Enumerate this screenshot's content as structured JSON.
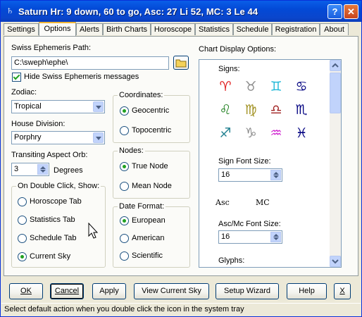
{
  "window": {
    "title": "Saturn Hr: 9 down, 60 to go, Asc: 27 Li 52, MC: 3 Le 44",
    "app_icon": "saturn-glyph",
    "help_btn": "?",
    "close_btn": "✕"
  },
  "tabs": [
    {
      "label": "Settings",
      "selected": false
    },
    {
      "label": "Options",
      "selected": true
    },
    {
      "label": "Alerts",
      "selected": false
    },
    {
      "label": "Birth Charts",
      "selected": false
    },
    {
      "label": "Horoscope",
      "selected": false
    },
    {
      "label": "Statistics",
      "selected": false
    },
    {
      "label": "Schedule",
      "selected": false
    },
    {
      "label": "Registration",
      "selected": false
    },
    {
      "label": "About",
      "selected": false
    }
  ],
  "ephemeris": {
    "label": "Swiss Ephemeris Path:",
    "value": "C:\\sweph\\ephe\\",
    "hide_label": "Hide Swiss Ephemeris messages",
    "hide_checked": true
  },
  "zodiac": {
    "label": "Zodiac:",
    "value": "Tropical"
  },
  "house": {
    "label": "House Division:",
    "value": "Porphry"
  },
  "orb": {
    "label": "Transiting Aspect Orb:",
    "value": "3",
    "unit": "Degrees"
  },
  "double_click": {
    "title": "On Double Click, Show:",
    "options": [
      "Horoscope Tab",
      "Statistics Tab",
      "Schedule Tab",
      "Current Sky"
    ],
    "selected": 3
  },
  "coordinates": {
    "title": "Coordinates:",
    "options": [
      "Geocentric",
      "Topocentric"
    ],
    "selected": 0
  },
  "nodes": {
    "title": "Nodes:",
    "options": [
      "True Node",
      "Mean Node"
    ],
    "selected": 0
  },
  "date_format": {
    "title": "Date Format:",
    "options": [
      "European",
      "American",
      "Scientific"
    ],
    "selected": 0
  },
  "chart_display": {
    "title": "Chart Display Options:",
    "signs_label": "Signs:",
    "signs": [
      {
        "glyph": "♈",
        "color": "#e02020"
      },
      {
        "glyph": "♉",
        "color": "#8c8c8c"
      },
      {
        "glyph": "♊",
        "color": "#20b8d8"
      },
      {
        "glyph": "♋",
        "color": "#000080"
      },
      {
        "glyph": "♌",
        "color": "#208020"
      },
      {
        "glyph": "♍",
        "color": "#a09020"
      },
      {
        "glyph": "♎",
        "color": "#a02020"
      },
      {
        "glyph": "♏",
        "color": "#000080"
      },
      {
        "glyph": "♐",
        "color": "#208090"
      },
      {
        "glyph": "♑",
        "color": "#8c8c8c"
      },
      {
        "glyph": "♒",
        "color": "#d020d0"
      },
      {
        "glyph": "♓",
        "color": "#000080"
      }
    ],
    "sign_font_label": "Sign Font Size:",
    "sign_font_size": "16",
    "asc_label": "Asc",
    "mc_label": "MC",
    "ascmc_font_label": "Asc/Mc Font Size:",
    "ascmc_font_size": "16",
    "glyphs_label": "Glyphs:"
  },
  "buttons": {
    "ok": "OK",
    "cancel": "Cancel",
    "apply": "Apply",
    "view_sky": "View Current Sky",
    "wizard": "Setup Wizard",
    "help": "Help",
    "close": "X"
  },
  "status": "Select default action when you double click the icon in the system tray"
}
